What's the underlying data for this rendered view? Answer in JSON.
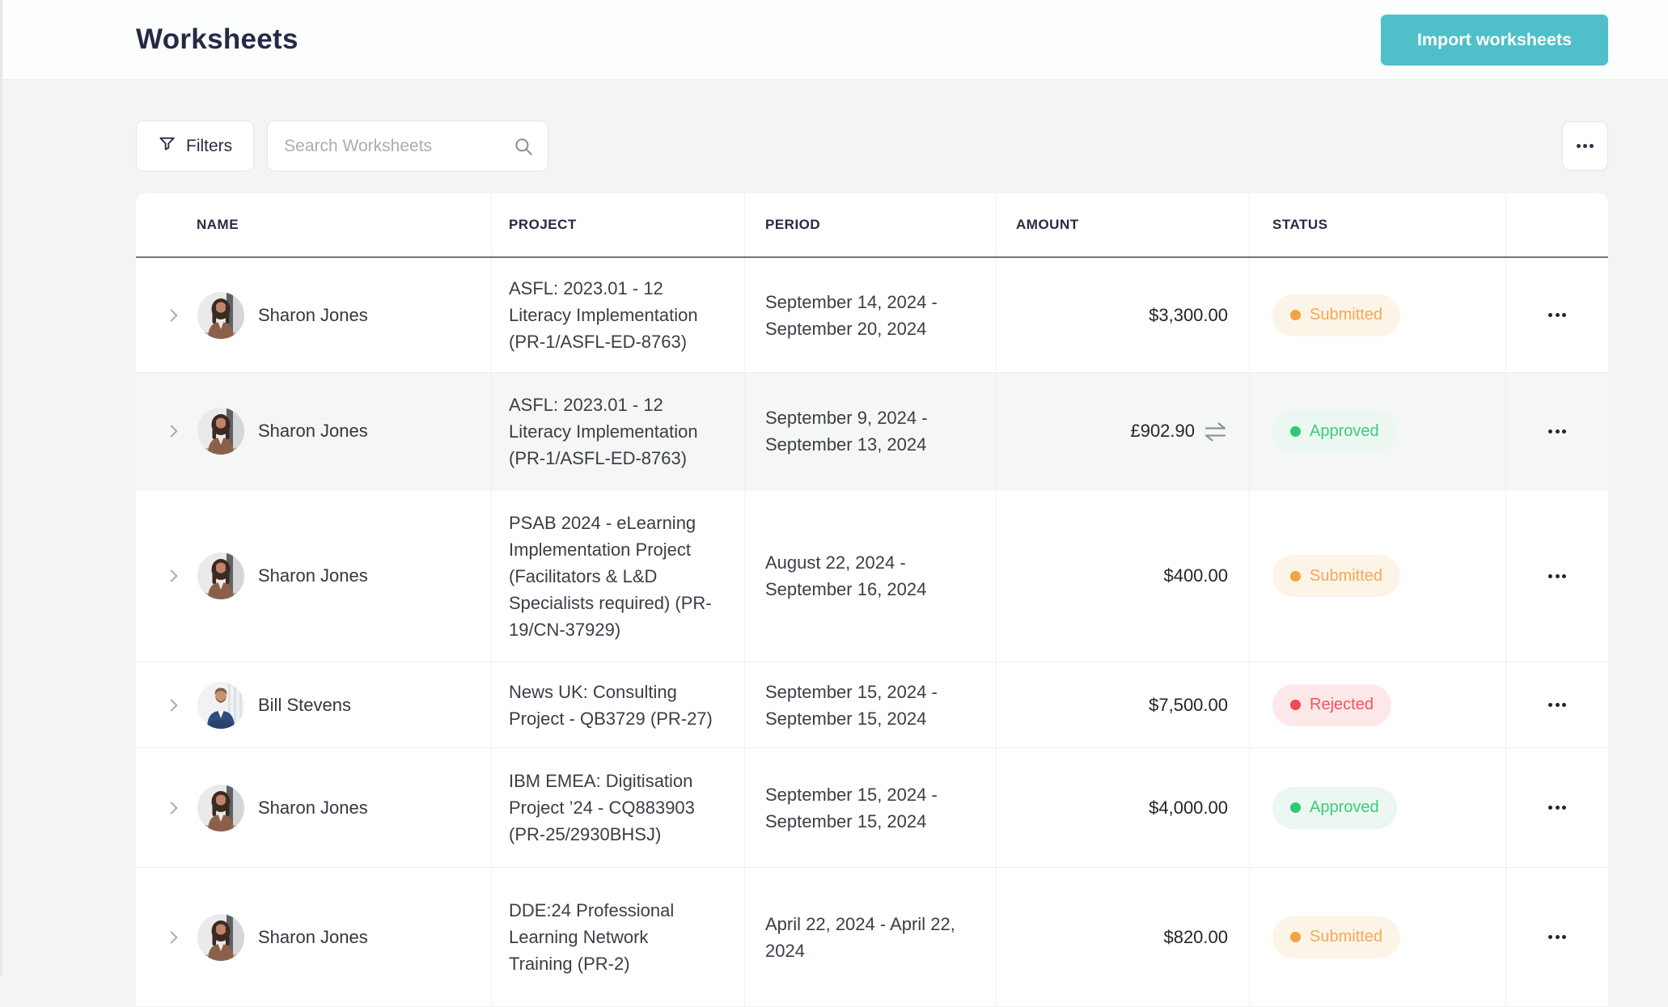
{
  "header": {
    "title": "Worksheets",
    "import_button": "Import worksheets"
  },
  "toolbar": {
    "filters_button": "Filters",
    "search_placeholder": "Search Worksheets",
    "more_button_icon": "ellipsis-icon"
  },
  "colors": {
    "accent_teal": "#4FBFC9",
    "status_submitted": "#F5A84D",
    "status_approved": "#2EC878",
    "status_rejected": "#F6545C"
  },
  "table": {
    "columns": [
      "NAME",
      "PROJECT",
      "PERIOD",
      "AMOUNT",
      "STATUS"
    ],
    "status_styles": {
      "Submitted": {
        "bg": "#FDF4E8",
        "text": "#F5A855",
        "dot": "#F5A342"
      },
      "Approved": {
        "bg": "#EBF7F0",
        "text": "#3FCA7D",
        "dot": "#2EC878"
      },
      "Rejected": {
        "bg": "#FDE8E9",
        "text": "#F6545C",
        "dot": "#F6464F"
      }
    },
    "rows": [
      {
        "name": "Sharon Jones",
        "avatar": "sharon",
        "project": "ASFL: 2023.01 - 12 Literacy Implementation (PR-1/ASFL-ED-8763)",
        "period": "September 14, 2024 - September 20, 2024",
        "amount": "$3,300.00",
        "has_exchange_icon": false,
        "status": "Submitted",
        "highlighted": false
      },
      {
        "name": "Sharon Jones",
        "avatar": "sharon",
        "project": "ASFL: 2023.01 - 12 Literacy Implementation (PR-1/ASFL-ED-8763)",
        "period": "September 9, 2024 - September 13, 2024",
        "amount": "£902.90",
        "has_exchange_icon": true,
        "status": "Approved",
        "highlighted": true
      },
      {
        "name": "Sharon Jones",
        "avatar": "sharon",
        "project": "PSAB 2024 - eLearning Implementation Project (Facilitators & L&D Specialists required) (PR-19/CN-37929)",
        "period": "August 22, 2024 - September 16, 2024",
        "amount": "$400.00",
        "has_exchange_icon": false,
        "status": "Submitted",
        "highlighted": false
      },
      {
        "name": "Bill Stevens",
        "avatar": "bill",
        "project": "News UK: Consulting Project - QB3729 (PR-27)",
        "period": "September 15, 2024 - September 15, 2024",
        "amount": "$7,500.00",
        "has_exchange_icon": false,
        "status": "Rejected",
        "highlighted": false
      },
      {
        "name": "Sharon Jones",
        "avatar": "sharon",
        "project": "IBM EMEA: Digitisation Project ’24 - CQ883903 (PR-25/2930BHSJ)",
        "period": "September 15, 2024 - September 15, 2024",
        "amount": "$4,000.00",
        "has_exchange_icon": false,
        "status": "Approved",
        "highlighted": false
      },
      {
        "name": "Sharon Jones",
        "avatar": "sharon",
        "project": "DDE:24 Professional Learning Network Training (PR-2)",
        "period": "April 22, 2024 - April 22, 2024",
        "amount": "$820.00",
        "has_exchange_icon": false,
        "status": "Submitted",
        "highlighted": false
      }
    ]
  }
}
